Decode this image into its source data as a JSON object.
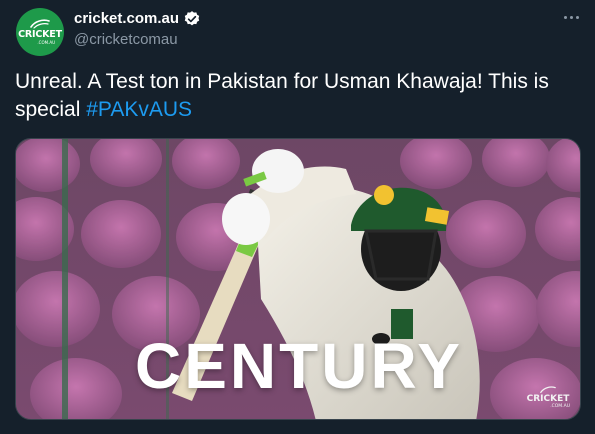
{
  "author": {
    "avatar_word": "CRICKET",
    "avatar_sub": ".COM.AU",
    "display_name": "cricket.com.au",
    "handle": "@cricketcomau",
    "verified": true,
    "brand_color": "#1e9a4a"
  },
  "more_menu": {
    "icon": "more-horizontal-icon"
  },
  "tweet": {
    "text": "Unreal. A Test ton in Pakistan for Usman Khawaja! This is special ",
    "hashtag": "#PAKvAUS"
  },
  "media": {
    "overlay_text": "CENTURY",
    "watermark_word": "CRICKET",
    "watermark_sub": ".COM.AU"
  },
  "colors": {
    "background": "#15202b",
    "text_primary": "#ffffff",
    "text_secondary": "#8b98a5",
    "link": "#1d9bf0",
    "verified_badge": "#ffffff"
  }
}
